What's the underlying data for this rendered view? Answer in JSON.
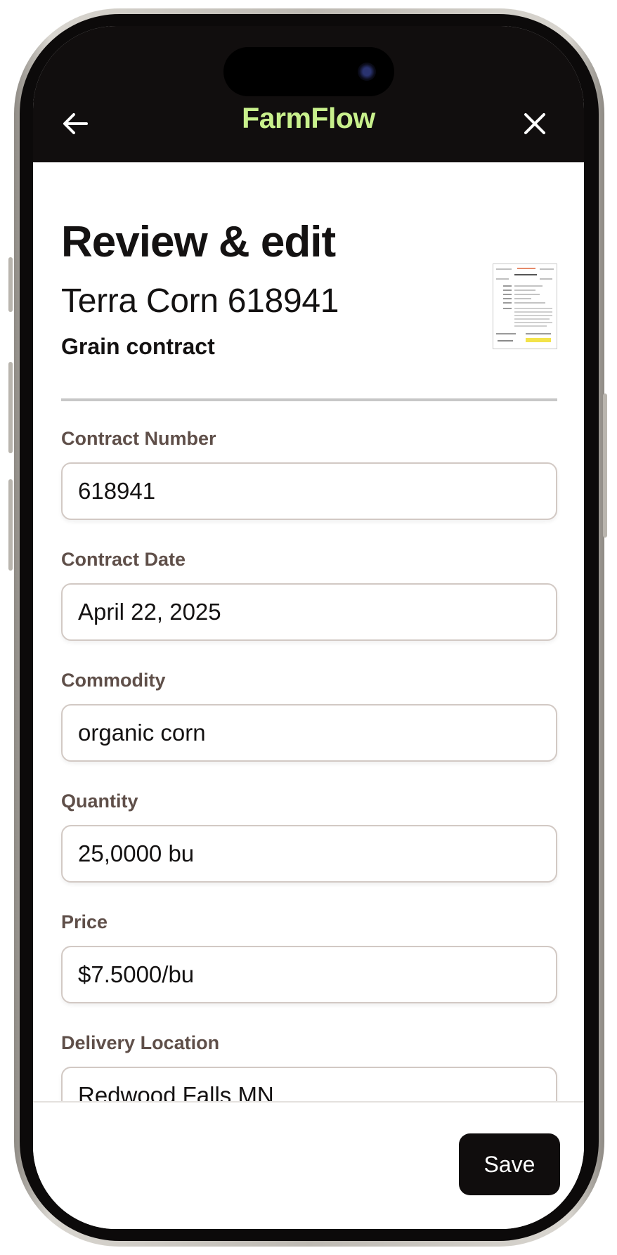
{
  "app": {
    "name": "FarmFlow",
    "brand_color": "#c8f08c",
    "topbar_color": "#110e0e"
  },
  "nav": {
    "back_icon": "arrow-left-icon",
    "close_icon": "close-icon"
  },
  "header": {
    "title": "Review & edit",
    "contract_name": "Terra Corn 618941",
    "contract_type": "Grain contract"
  },
  "fields": [
    {
      "label": "Contract Number",
      "value": "618941"
    },
    {
      "label": "Contract Date",
      "value": "April 22, 2025"
    },
    {
      "label": "Commodity",
      "value": "organic corn"
    },
    {
      "label": "Quantity",
      "value": "25,0000 bu"
    },
    {
      "label": "Price",
      "value": "$7.5000/bu"
    },
    {
      "label": "Delivery Location",
      "value": "Redwood Falls MN"
    }
  ],
  "footer": {
    "save_label": "Save"
  }
}
